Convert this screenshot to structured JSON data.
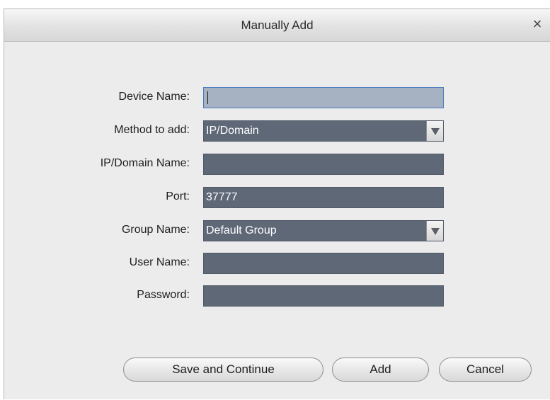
{
  "dialog": {
    "title": "Manually Add",
    "close_label": "×"
  },
  "form": {
    "device_name": {
      "label": "Device Name:",
      "value": ""
    },
    "method_to_add": {
      "label": "Method to add:",
      "value": "IP/Domain"
    },
    "ip_domain_name": {
      "label": "IP/Domain Name:",
      "value": ""
    },
    "port": {
      "label": "Port:",
      "value": "37777"
    },
    "group_name": {
      "label": "Group Name:",
      "value": "Default Group"
    },
    "user_name": {
      "label": "User Name:",
      "value": ""
    },
    "password": {
      "label": "Password:",
      "value": ""
    }
  },
  "buttons": {
    "save_continue": "Save and Continue",
    "add": "Add",
    "cancel": "Cancel"
  },
  "icons": {
    "close": "close-icon",
    "dropdown": "chevron-down-icon"
  },
  "colors": {
    "field_bg": "#5f6877",
    "focused_field_bg": "#a6b1c1",
    "dialog_bg": "#ececec"
  }
}
